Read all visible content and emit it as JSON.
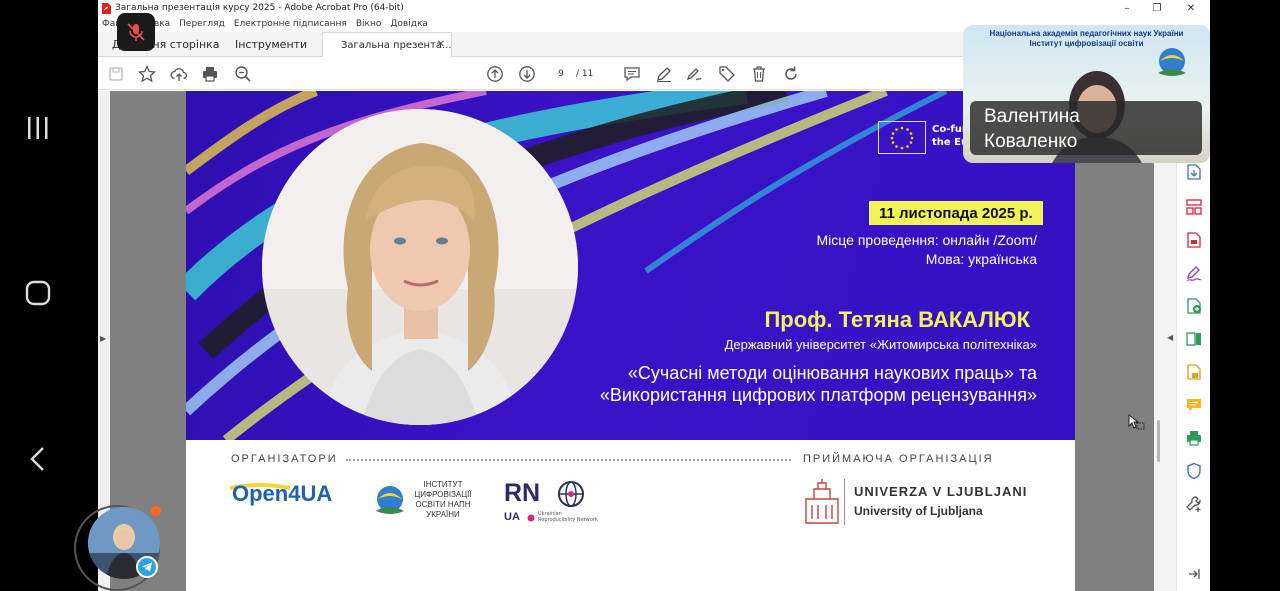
{
  "window": {
    "title": "Загальна презентація  курсу 2025 - Adobe Acrobat Pro (64-bit)",
    "controls": {
      "minimize": "–",
      "maximize": "❐",
      "close": "✕"
    }
  },
  "menu": [
    "Файл",
    "Правка",
    "Перегляд",
    "Електронне підписання",
    "Вікно",
    "Довідка"
  ],
  "tabs": {
    "home": "Домашня сторінка",
    "tools": "Інструменти",
    "document": "Загальна презента...",
    "close": "✕"
  },
  "toolbar": {
    "current_page": "9",
    "total_pages": "/  11"
  },
  "slide": {
    "eu_text_line1": "Co-fun",
    "eu_text_line2": "the Eu",
    "date": "11 листопада 2025 р.",
    "venue": "Місце проведення: онлайн /Zoom/",
    "language": "Мова: українська",
    "speaker": "Проф. Тетяна ВАКАЛЮК",
    "university": "Державний університет «Житомирська політехніка»",
    "topic_line1": "«Сучасні методи оцінювання наукових праць» та",
    "topic_line2": "«Використання цифрових платформ рецензування»",
    "organizers_label": "ОРГАНІЗАТОРИ",
    "host_label": "ПРИЙМАЮЧА ОРГАНІЗАЦІЯ",
    "logo_open4ua": "Open4UA",
    "logo_institute": "ІНСТИТУТ ЦИФРОВІЗАЦІЇ ОСВІТИ НАПН УКРАЇНИ",
    "logo_rn": "RN",
    "logo_ua": "UA",
    "logo_rn_sub": "Ukrainian Reproducibility Network",
    "university_host": "UNIVERZA V LJUBLJANI",
    "university_host_en": "University of Ljubljana"
  },
  "video": {
    "header_line1": "Національна академія педагогічних наук України",
    "header_line2": "Інститут цифровізації освіти",
    "name_line1": "Валентина",
    "name_line2": "Коваленко"
  },
  "colors": {
    "banner": "#3511c1",
    "accent_yellow": "#f2f25a",
    "acrobat_red": "#d9261c",
    "telegram": "#2aa3e0"
  }
}
